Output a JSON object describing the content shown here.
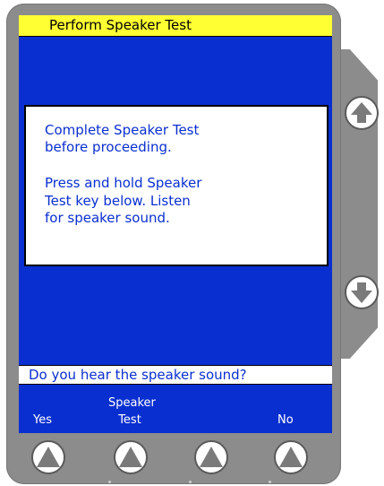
{
  "title": "Perform Speaker Test",
  "message": {
    "line1": "Complete Speaker Test",
    "line2": "before proceeding.",
    "line3": "Press and hold Speaker",
    "line4": "Test key below. Listen",
    "line5": "for speaker sound."
  },
  "prompt": "Do you hear the speaker sound?",
  "softkeys": {
    "key1": "Yes",
    "key2_line1": "Speaker",
    "key2_line2": "Test",
    "key3": "",
    "key4": "No"
  },
  "colors": {
    "screen": "#0a2fd0",
    "title_bar": "#ffff33",
    "bezel": "#8c8c8c"
  },
  "icons": {
    "scroll_up": "up-arrow-icon",
    "scroll_down": "down-arrow-icon",
    "softkey": "up-triangle-icon"
  }
}
